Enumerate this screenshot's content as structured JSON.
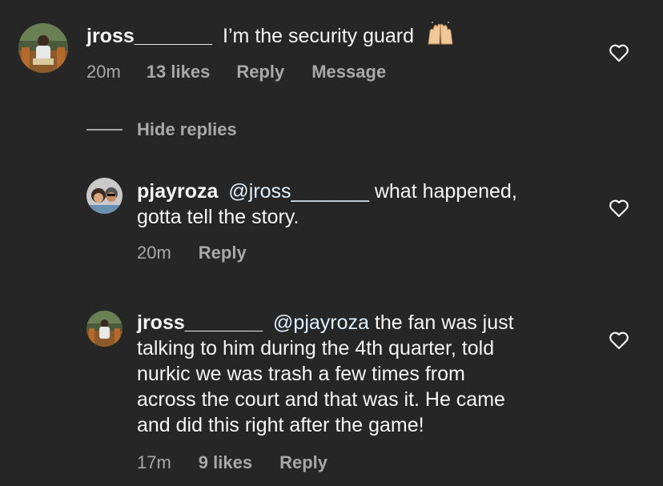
{
  "comment": {
    "username": "jross_______",
    "text": "I’m the security guard",
    "emoji": "raising-hands-emoji",
    "time": "20m",
    "likes": "13 likes",
    "reply_label": "Reply",
    "message_label": "Message"
  },
  "hide_replies_label": "Hide replies",
  "replies": [
    {
      "username": "pjayroza",
      "mention": "@jross_______",
      "text_line1": " what happened,",
      "text_line2": "gotta tell the story.",
      "time": "20m",
      "reply_label": "Reply"
    },
    {
      "username": "jross_______",
      "mention": "@pjayroza",
      "text_line1": " the fan was just",
      "text_line2": "talking to him during the 4th quarter, told",
      "text_line3": "nurkic we was trash a few times from",
      "text_line4": "across the court and that was it. He came",
      "text_line5": "and did this right after the game!",
      "time": "17m",
      "likes": "9 likes",
      "reply_label": "Reply"
    }
  ],
  "colors": {
    "background": "#262626",
    "text": "#f5f5f5",
    "meta": "#a8a8a8",
    "mention": "#e0f1ff"
  }
}
